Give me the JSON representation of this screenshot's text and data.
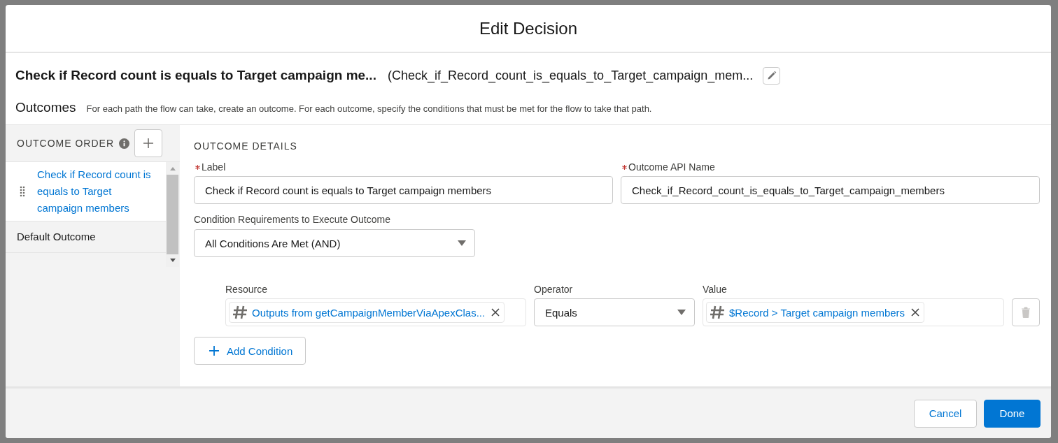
{
  "dialog": {
    "title": "Edit Decision"
  },
  "element": {
    "label": "Check if Record count is equals to Target campaign me...",
    "api_name": "(Check_if_Record_count_is_equals_to_Target_campaign_mem..."
  },
  "outcomes_intro": {
    "title": "Outcomes",
    "description": "For each path the flow can take, create an outcome. For each outcome, specify the conditions that must be met for the flow to take that path."
  },
  "outcome_order": {
    "heading": "OUTCOME ORDER",
    "items": [
      {
        "label": "Check if Record count is equals to Target campaign members",
        "selected": true
      },
      {
        "label": "Default Outcome",
        "selected": false
      }
    ]
  },
  "outcome_details": {
    "heading": "OUTCOME DETAILS",
    "fields": [
      {
        "label": "Label",
        "required": true,
        "value": "Check if Record count is equals to Target campaign members"
      },
      {
        "label": "Outcome API Name",
        "required": true,
        "value": "Check_if_Record_count_is_equals_to_Target_campaign_members"
      }
    ],
    "condition_requirements": {
      "label": "Condition Requirements to Execute Outcome",
      "value": "All Conditions Are Met (AND)"
    },
    "condition_columns": [
      "Resource",
      "Operator",
      "Value"
    ],
    "conditions": [
      {
        "resource": "Outputs from getCampaignMemberViaApexClas...",
        "operator": "Equals",
        "value": "$Record > Target campaign members"
      }
    ],
    "add_condition": "Add Condition"
  },
  "footer": {
    "buttons": [
      {
        "label": "Cancel",
        "kind": "neutral"
      },
      {
        "label": "Done",
        "kind": "brand"
      }
    ]
  }
}
